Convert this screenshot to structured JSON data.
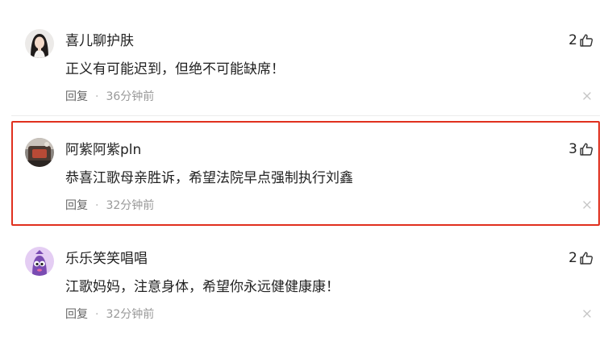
{
  "comments": [
    {
      "username": "喜儿聊护肤",
      "content": "正义有可能迟到，但绝不可能缺席！",
      "reply_label": "回复",
      "separator": "·",
      "time": "36分钟前",
      "likes": "2",
      "avatar_icon": "woman-portrait-avatar"
    },
    {
      "username": "阿紫阿紫pln",
      "content": "恭喜江歌母亲胜诉，希望法院早点强制执行刘鑫",
      "reply_label": "回复",
      "separator": "·",
      "time": "32分钟前",
      "likes": "3",
      "avatar_icon": "photo-avatar",
      "highlight_color": "#e0301e"
    },
    {
      "username": "乐乐笑笑唱唱",
      "content": "江歌妈妈，注意身体，希望你永远健健康康！",
      "reply_label": "回复",
      "separator": "·",
      "time": "32分钟前",
      "likes": "2",
      "avatar_icon": "cartoon-character-avatar"
    }
  ],
  "icons": {
    "like": "thumbs-up-icon",
    "dismiss": "close-icon"
  }
}
